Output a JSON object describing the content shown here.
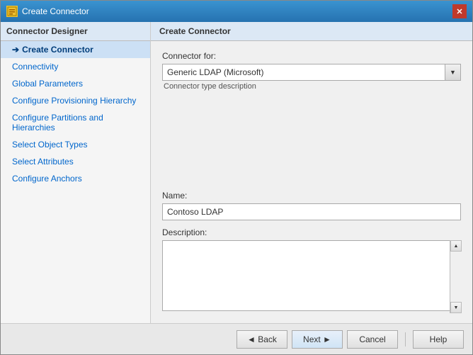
{
  "window": {
    "title": "Create Connector",
    "icon": "⚙"
  },
  "sidebar": {
    "header": "Connector Designer",
    "items": [
      {
        "id": "create-connector",
        "label": "Create Connector",
        "active": true,
        "arrow": true
      },
      {
        "id": "connectivity",
        "label": "Connectivity",
        "active": false,
        "arrow": false
      },
      {
        "id": "global-parameters",
        "label": "Global Parameters",
        "active": false,
        "arrow": false
      },
      {
        "id": "configure-provisioning-hierarchy",
        "label": "Configure Provisioning Hierarchy",
        "active": false,
        "arrow": false
      },
      {
        "id": "configure-partitions-and-hierarchies",
        "label": "Configure Partitions and Hierarchies",
        "active": false,
        "arrow": false
      },
      {
        "id": "select-object-types",
        "label": "Select Object Types",
        "active": false,
        "arrow": false
      },
      {
        "id": "select-attributes",
        "label": "Select Attributes",
        "active": false,
        "arrow": false
      },
      {
        "id": "configure-anchors",
        "label": "Configure Anchors",
        "active": false,
        "arrow": false
      }
    ]
  },
  "main": {
    "header": "Create Connector",
    "connector_for_label": "Connector for:",
    "connector_value": "Generic LDAP (Microsoft)",
    "connector_type_description": "Connector type description",
    "name_label": "Name:",
    "name_value": "Contoso LDAP",
    "description_label": "Description:",
    "description_value": ""
  },
  "footer": {
    "back_label": "◄ Back",
    "next_label": "Next ►",
    "cancel_label": "Cancel",
    "help_label": "Help"
  }
}
